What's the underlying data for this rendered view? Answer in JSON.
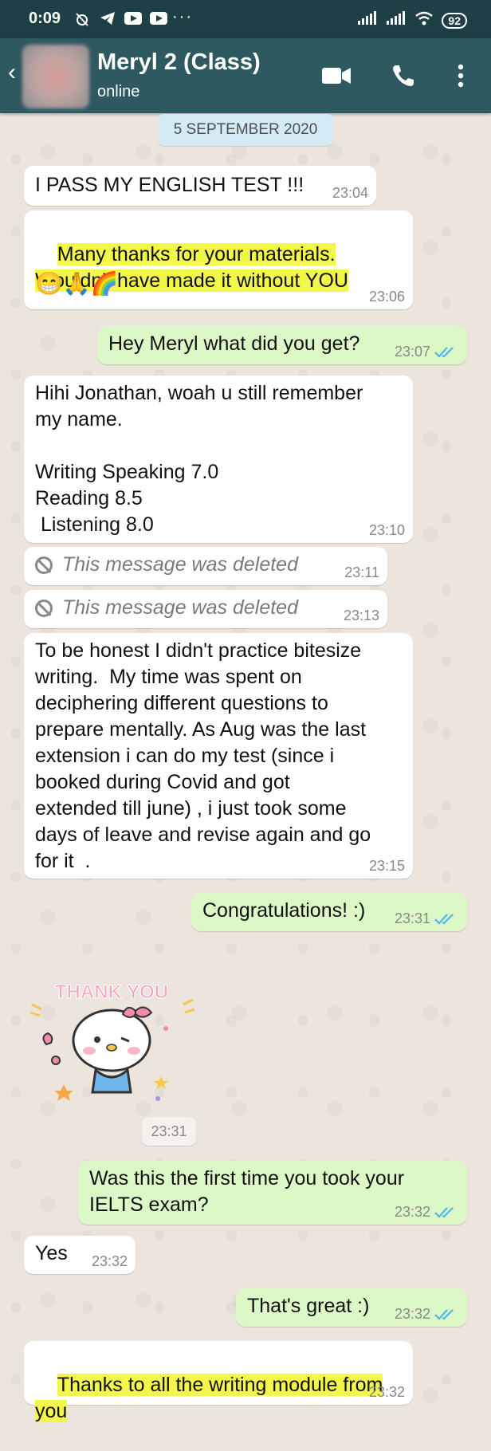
{
  "status_bar": {
    "time": "0:09",
    "dots": "···",
    "battery": "92"
  },
  "header": {
    "contact_name": "Meryl 2 (Class)",
    "status": "online"
  },
  "date_chip": "5 SEPTEMBER 2020",
  "messages": [
    {
      "dir": "in",
      "text": "I PASS MY ENGLISH TEST !!!",
      "time": "23:04"
    },
    {
      "dir": "in",
      "text": "Many thanks for your materials.\nWouldn't have made it without YOU",
      "emojis": "😁🙏🌈",
      "time": "23:06",
      "highlight": true
    },
    {
      "dir": "out",
      "text": "Hey Meryl what did you get?",
      "time": "23:07"
    },
    {
      "dir": "in",
      "text": "Hihi Jonathan, woah u still remember\nmy name.\n\nWriting Speaking 7.0\nReading 8.5\n Listening 8.0",
      "time": "23:10"
    },
    {
      "dir": "in",
      "deleted": true,
      "text": "This message was deleted",
      "time": "23:11"
    },
    {
      "dir": "in",
      "deleted": true,
      "text": "This message was deleted",
      "time": "23:13"
    },
    {
      "dir": "in",
      "text": "To be honest I didn't practice bitesize\nwriting.  My time was spent on\ndeciphering different questions to\nprepare mentally. As Aug was the last\nextension i can do my test (since i\nbooked during Covid and got\nextended till june) , i just took some\ndays of leave and revise again and go\nfor it  .",
      "time": "23:15"
    },
    {
      "dir": "out",
      "text": "Congratulations! :)",
      "time": "23:31"
    },
    {
      "dir": "in",
      "sticker": "thank-you-sticker",
      "sticker_text": "THANK YOU",
      "time": "23:31"
    },
    {
      "dir": "out",
      "text": "Was this the first time you took your\nIELTS exam?",
      "time": "23:32"
    },
    {
      "dir": "in",
      "text": "Yes",
      "time": "23:32"
    },
    {
      "dir": "out",
      "text": "That's great :)",
      "time": "23:32"
    },
    {
      "dir": "in",
      "text": "Thanks to all the writing module from\nyou",
      "time": "23:32",
      "highlight": true
    }
  ],
  "colors": {
    "header": "#2F5960",
    "status_bar": "#1E3F46",
    "incoming": "#FFFFFF",
    "outgoing": "#DCF8C6",
    "highlight": "#F3F74A",
    "read_ticks": "#4FB6EC"
  }
}
